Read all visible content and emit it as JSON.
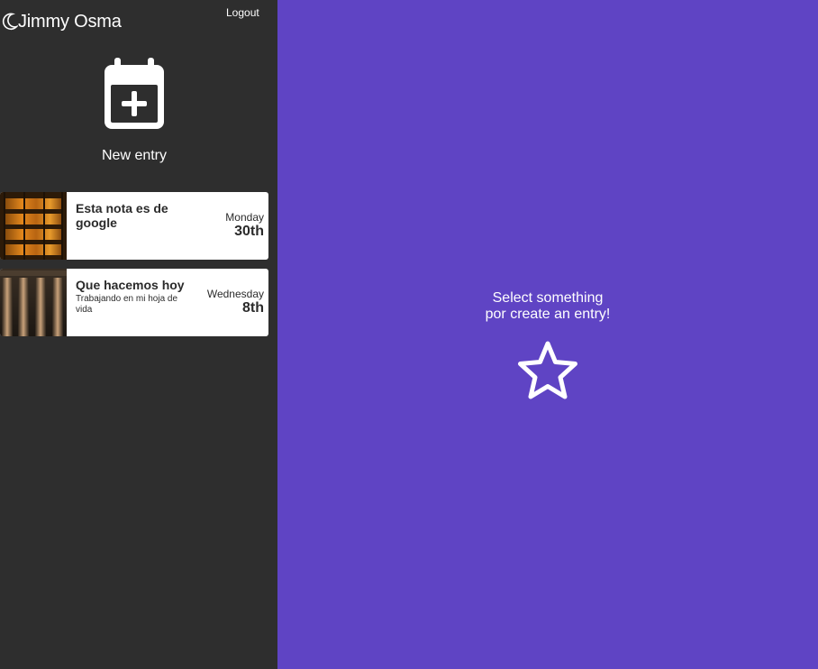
{
  "navbar": {
    "user_name": "Jimmy Osma",
    "logout_label": "Logout",
    "icon": "moon-icon"
  },
  "new_entry": {
    "label": "New entry",
    "icon": "calendar-plus-icon"
  },
  "entries": [
    {
      "title": "Esta nota es de google",
      "body": "",
      "day": "Monday",
      "day_number": "30th"
    },
    {
      "title": "Que hacemos hoy",
      "body": "Trabajando en mi hoja de vida",
      "day": "Wednesday",
      "day_number": "8th"
    }
  ],
  "main": {
    "message_line_1": "Select something",
    "message_line_2": "por create an entry!",
    "icon": "star-icon"
  },
  "colors": {
    "sidebar_bg": "#2e2e2e",
    "main_bg": "#5f44c4",
    "card_bg": "#ffffff"
  }
}
